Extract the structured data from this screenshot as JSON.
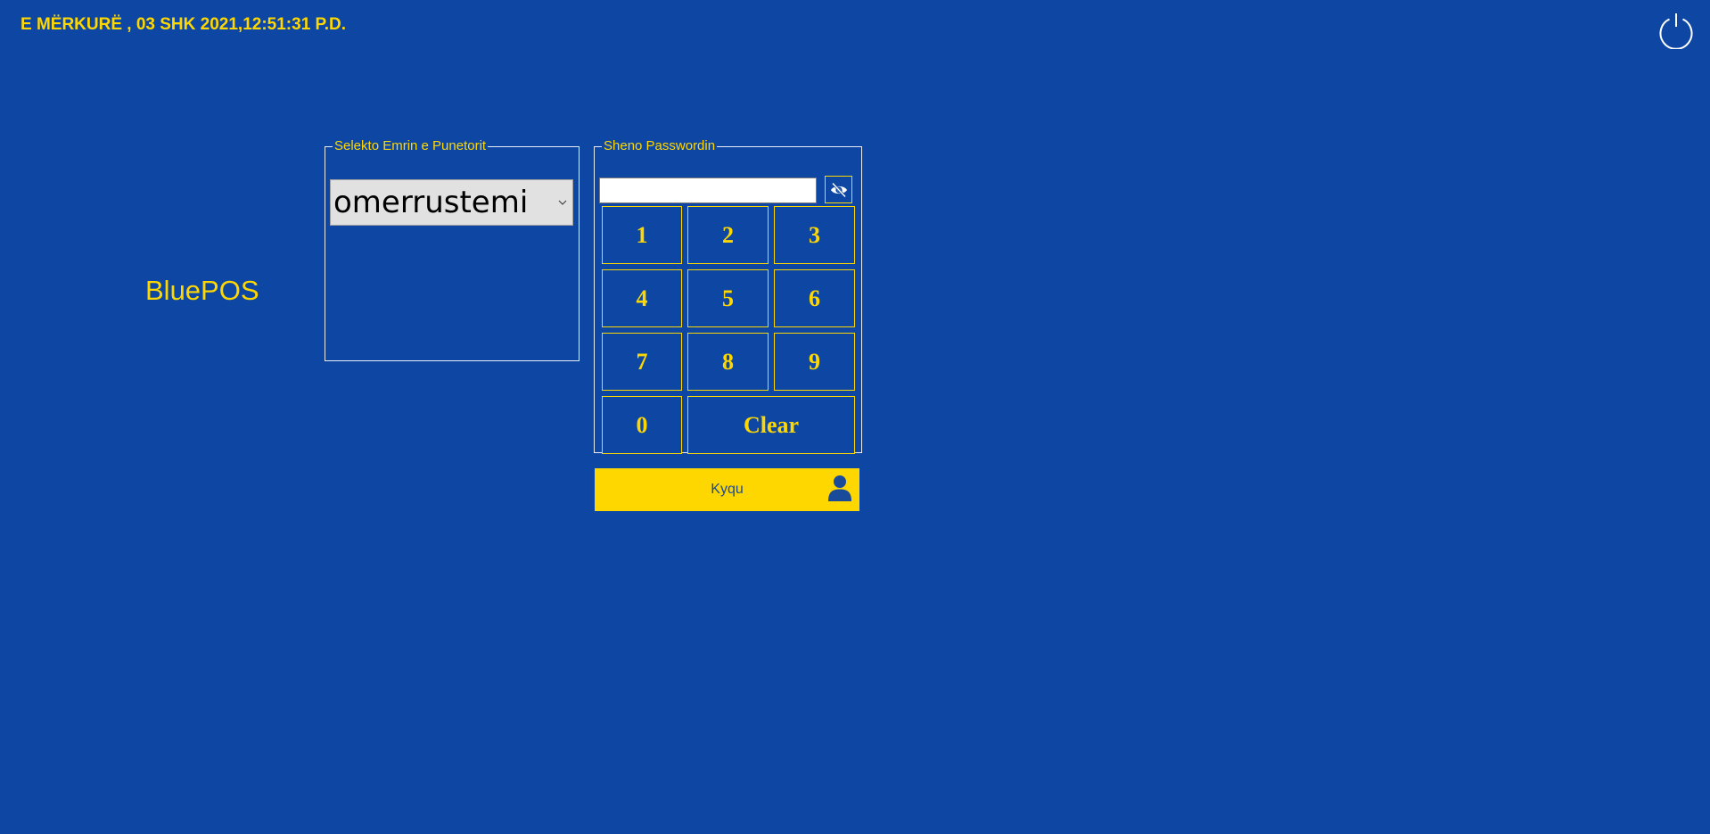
{
  "header": {
    "datetime": "E MËRKURË , 03 SHK 2021,12:51:31 P.D."
  },
  "brand": {
    "name": "BluePOS"
  },
  "employee_panel": {
    "legend": "Selekto Emrin e Punetorit",
    "selected_value": "omerrustemi"
  },
  "password_panel": {
    "legend": "Sheno Passwordin",
    "input_value": "",
    "keys": {
      "k1": "1",
      "k2": "2",
      "k3": "3",
      "k4": "4",
      "k5": "5",
      "k6": "6",
      "k7": "7",
      "k8": "8",
      "k9": "9",
      "k0": "0",
      "clear": "Clear"
    }
  },
  "login": {
    "label": "Kyqu"
  },
  "icons": {
    "power": "power-icon",
    "toggle_visibility": "eye-slash-icon",
    "dropdown": "chevron-down-icon",
    "login": "user-icon"
  },
  "colors": {
    "background": "#0e47a3",
    "accent": "#ffd700",
    "border": "#e8eefb",
    "login_text": "#1a4a9a"
  }
}
